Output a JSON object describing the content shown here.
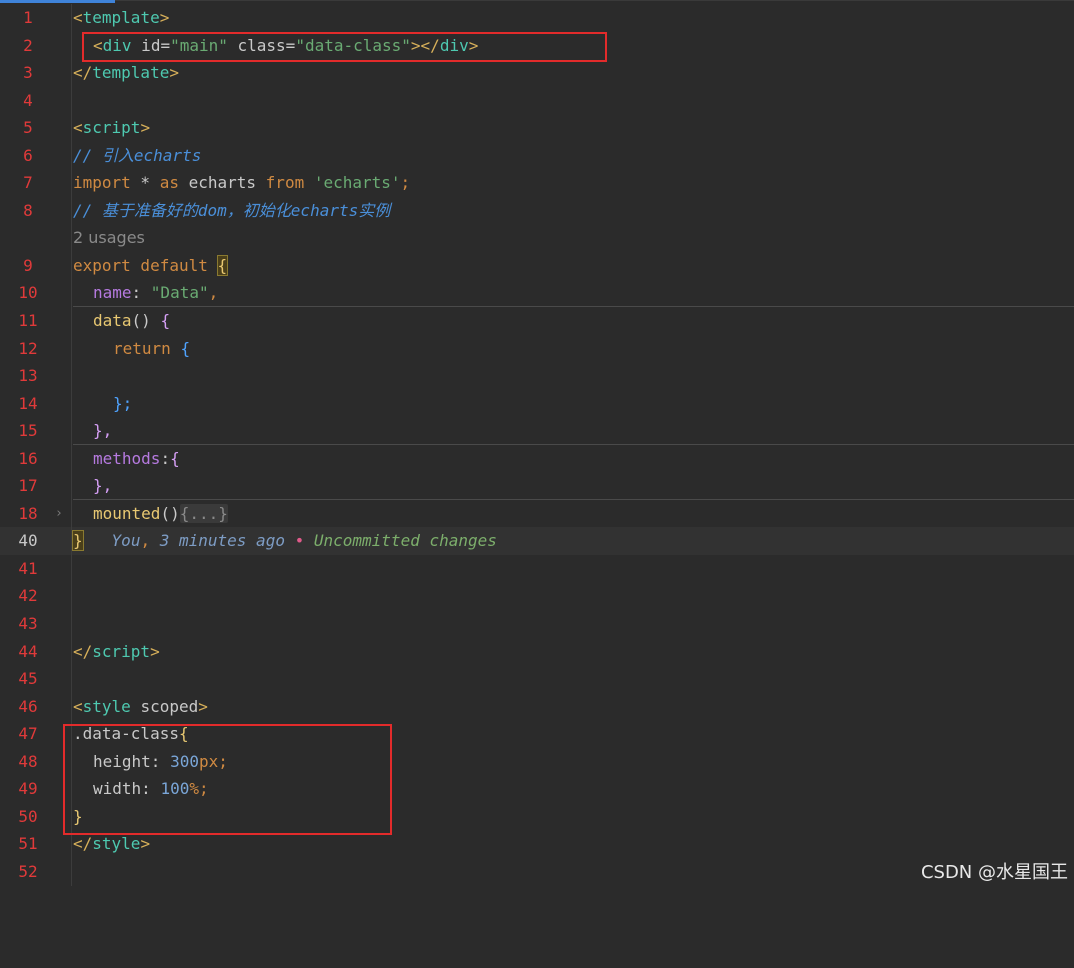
{
  "lines": [
    {
      "num": "1",
      "id": "l1"
    },
    {
      "num": "2",
      "id": "l2"
    },
    {
      "num": "3",
      "id": "l3"
    },
    {
      "num": "4",
      "id": "l4"
    },
    {
      "num": "5",
      "id": "l5"
    },
    {
      "num": "6",
      "id": "l6"
    },
    {
      "num": "7",
      "id": "l7"
    },
    {
      "num": "8",
      "id": "l8"
    },
    {
      "num": "",
      "id": "usages"
    },
    {
      "num": "9",
      "id": "l9"
    },
    {
      "num": "10",
      "id": "l10"
    },
    {
      "num": "11",
      "id": "l11"
    },
    {
      "num": "12",
      "id": "l12"
    },
    {
      "num": "13",
      "id": "l13"
    },
    {
      "num": "14",
      "id": "l14"
    },
    {
      "num": "15",
      "id": "l15"
    },
    {
      "num": "16",
      "id": "l16"
    },
    {
      "num": "17",
      "id": "l17"
    },
    {
      "num": "18",
      "id": "l18"
    },
    {
      "num": "40",
      "id": "l40"
    },
    {
      "num": "41",
      "id": "l41"
    },
    {
      "num": "42",
      "id": "l42"
    },
    {
      "num": "43",
      "id": "l43"
    },
    {
      "num": "44",
      "id": "l44"
    },
    {
      "num": "45",
      "id": "l45"
    },
    {
      "num": "46",
      "id": "l46"
    },
    {
      "num": "47",
      "id": "l47"
    },
    {
      "num": "48",
      "id": "l48"
    },
    {
      "num": "49",
      "id": "l49"
    },
    {
      "num": "50",
      "id": "l50"
    },
    {
      "num": "51",
      "id": "l51"
    },
    {
      "num": "52",
      "id": "l52"
    }
  ],
  "code": {
    "lt": "<",
    "gt": ">",
    "close_lt": "</",
    "template": "template",
    "div": "div",
    "id_attr": " id=",
    "id_val": "\"main\"",
    "class_attr": " class=",
    "class_val": "\"data-class\"",
    "script": "script",
    "comment1": "// 引入echarts",
    "import_kw": "import",
    "import_star": " * ",
    "as_kw": "as",
    "echarts_ident": " echarts ",
    "from_kw": "from",
    "echarts_str": " 'echarts'",
    "semicolon": ";",
    "comment2": "// 基于准备好的dom，初始化echarts实例",
    "usages": "2 usages",
    "export_kw": "export",
    "default_kw": " default ",
    "open_brace": "{",
    "close_brace": "}",
    "name_key": "name",
    "colon_space": ": ",
    "name_val": "\"Data\"",
    "comma": ",",
    "data_fn": "data",
    "parens": "()",
    "space": " ",
    "return_kw": "return",
    "brace_semi": "};",
    "brace_comma": "},",
    "methods_key": "methods",
    "colon": ":",
    "mounted_fn": "mounted",
    "fold_placeholder": "{...}",
    "blame_you": "You",
    "blame_time": " 3 minutes ago ",
    "blame_dot": "•",
    "blame_msg": " Uncommitted changes",
    "style": "style",
    "scoped": " scoped",
    "selector": ".data-class",
    "height_key": "height",
    "height_num": "300",
    "height_unit": "px",
    "width_key": "width",
    "width_num": "100",
    "width_unit": "%"
  },
  "watermark": "CSDN @水星国王"
}
